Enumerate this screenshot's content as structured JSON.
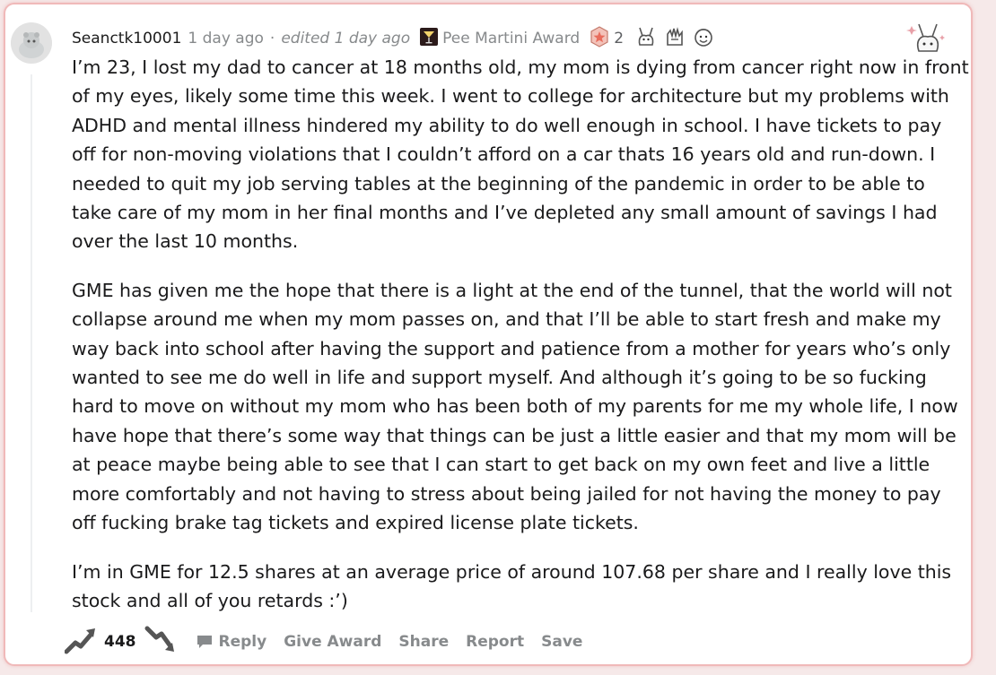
{
  "comment": {
    "author": "Seanctk10001",
    "posted": "1 day ago",
    "separator": "·",
    "edited": "edited 1 day ago",
    "award_name": "Pee Martini Award",
    "award_count": "2",
    "paragraphs": [
      "I’m 23, I lost my dad to cancer at 18 months old, my mom is dying from cancer right now in front of my eyes, likely some time this week. I went to college for architecture but my problems with ADHD and mental illness hindered my ability to do well enough in school. I have tickets to pay off for non-moving violations that I couldn’t afford on a car thats 16 years old and run-down. I needed to quit my job serving tables at the beginning of the pandemic in order to be able to take care of my mom in her final months and I’ve depleted any small amount of savings I had over the last 10 months.",
      "GME has given me the hope that there is a light at the end of the tunnel, that the world will not collapse around me when my mom passes on, and that I’ll be able to start fresh and make my way back into school after having the support and patience from a mother for years who’s only wanted to see me do well in life and support myself. And although it’s going to be so fucking hard to move on without my mom who has been both of my parents for me my whole life, I now have hope that there’s some way that things can be just a little easier and that my mom will be at peace maybe being able to see that I can start to get back on my own feet and live a little more comfortably and not having to stress about being jailed for not having the money to pay off fucking brake tag tickets and expired license plate tickets.",
      "I’m in GME for 12.5 shares at an average price of around 107.68 per share and I really love this stock and all of you retards :’)"
    ],
    "score": "448"
  },
  "actions": {
    "reply": "Reply",
    "give_award": "Give Award",
    "share": "Share",
    "report": "Report",
    "save": "Save"
  },
  "colors": {
    "card_border": "#f0b9b9",
    "meta_text": "#878a8c",
    "body_text": "#1a1a1b"
  }
}
